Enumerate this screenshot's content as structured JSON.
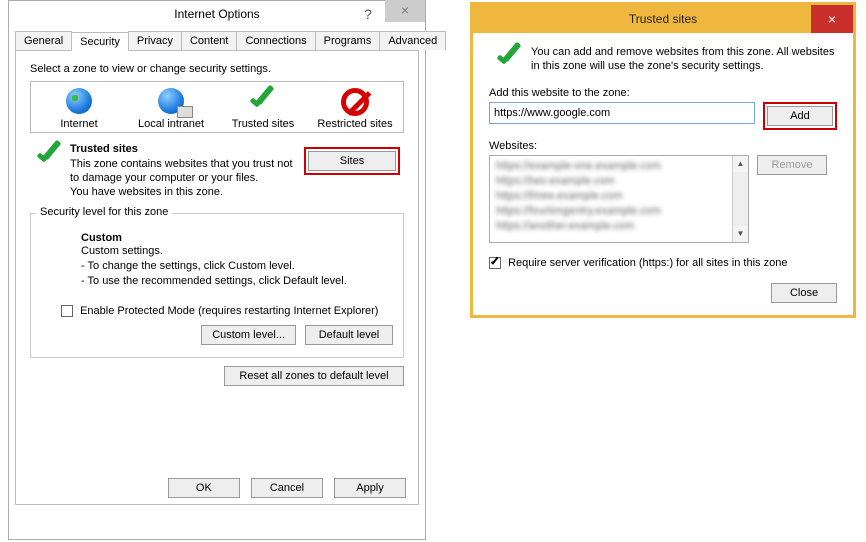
{
  "io": {
    "title": "Internet Options",
    "help_glyph": "?",
    "close_glyph": "×",
    "tabs": [
      "General",
      "Security",
      "Privacy",
      "Content",
      "Connections",
      "Programs",
      "Advanced"
    ],
    "active_tab_index": 1,
    "zone_instruction": "Select a zone to view or change security settings.",
    "zones": [
      {
        "label": "Internet"
      },
      {
        "label": "Local intranet"
      },
      {
        "label": "Trusted sites"
      },
      {
        "label": "Restricted sites"
      }
    ],
    "selected_zone_index": 2,
    "zone_detail": {
      "heading": "Trusted sites",
      "line1": "This zone contains websites that you trust not to damage your computer or your files.",
      "line2": "You have websites in this zone."
    },
    "sites_button": "Sites",
    "security_level_label": "Security level for this zone",
    "custom": {
      "heading": "Custom",
      "l1": "Custom settings.",
      "l2": "- To change the settings, click Custom level.",
      "l3": "- To use the recommended settings, click Default level."
    },
    "epm_label": "Enable Protected Mode (requires restarting Internet Explorer)",
    "epm_checked": false,
    "custom_level_btn": "Custom level...",
    "default_level_btn": "Default level",
    "reset_btn": "Reset all zones to default level",
    "ok": "OK",
    "cancel": "Cancel",
    "apply": "Apply"
  },
  "ts": {
    "title": "Trusted sites",
    "close_glyph": "×",
    "intro": "You can add and remove websites from this zone. All websites in this zone will use the zone's security settings.",
    "add_label": "Add this website to the zone:",
    "input_value": "https://www.google.com",
    "add_btn": "Add",
    "websites_label": "Websites:",
    "remove_btn": "Remove",
    "require_label": "Require server verification (https:) for all sites in this zone",
    "require_checked": true,
    "close_btn": "Close"
  }
}
